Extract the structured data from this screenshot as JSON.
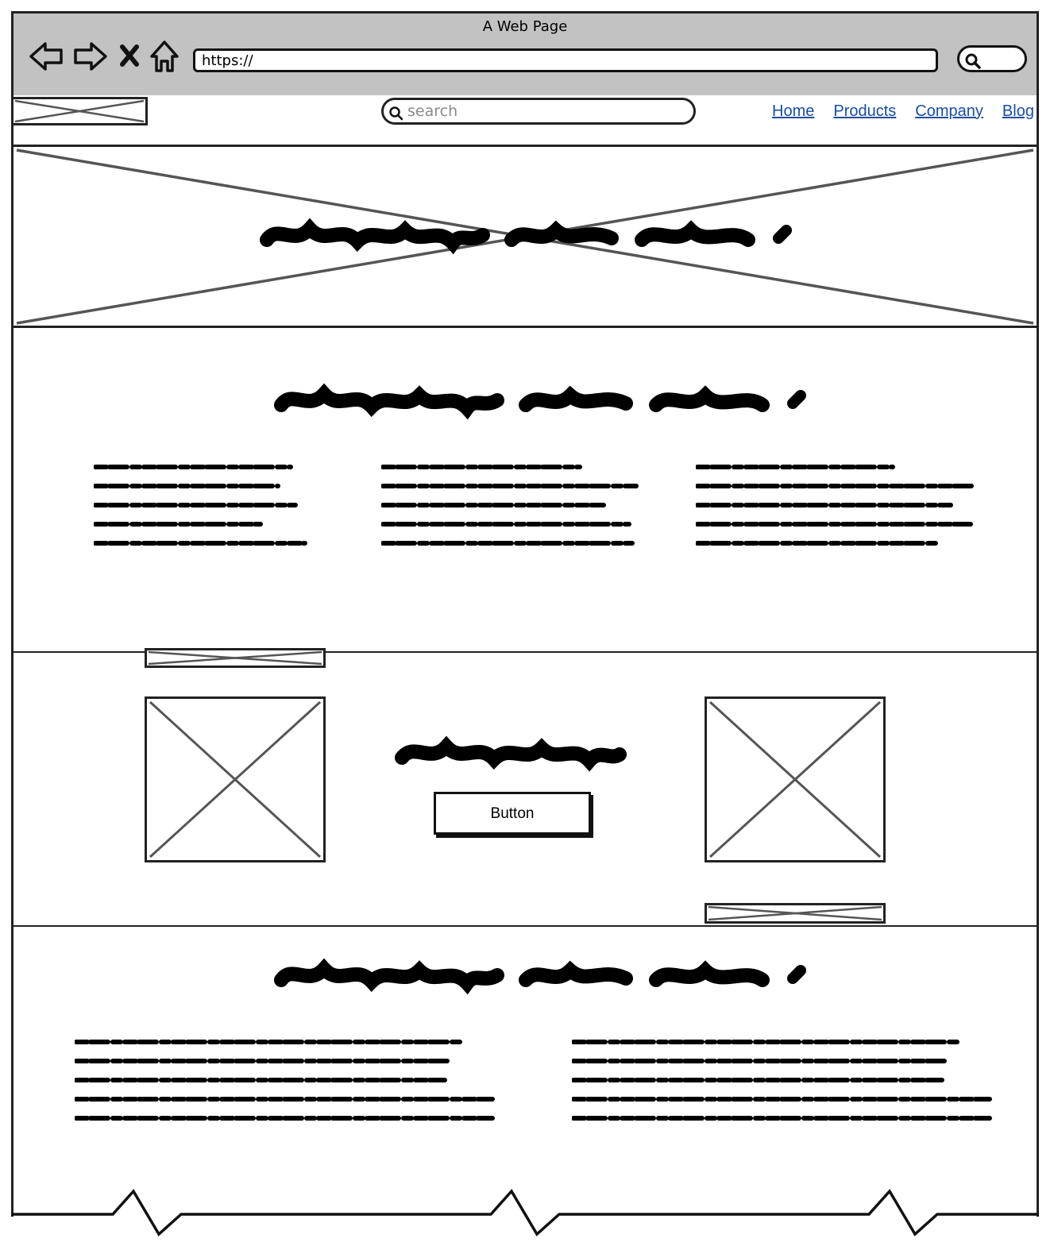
{
  "window": {
    "title": "A Web Page"
  },
  "toolbar": {
    "url": "https://",
    "icons": [
      "back-arrow-icon",
      "forward-arrow-icon",
      "close-icon",
      "home-icon",
      "search-icon"
    ]
  },
  "header": {
    "search_placeholder": "search",
    "nav": [
      "Home",
      "Products",
      "Company",
      "Blog"
    ]
  },
  "cta": {
    "button_label": "Button"
  },
  "colors": {
    "chrome": "#c2c2c2",
    "link": "#1a4d9e",
    "outline": "#222222"
  }
}
